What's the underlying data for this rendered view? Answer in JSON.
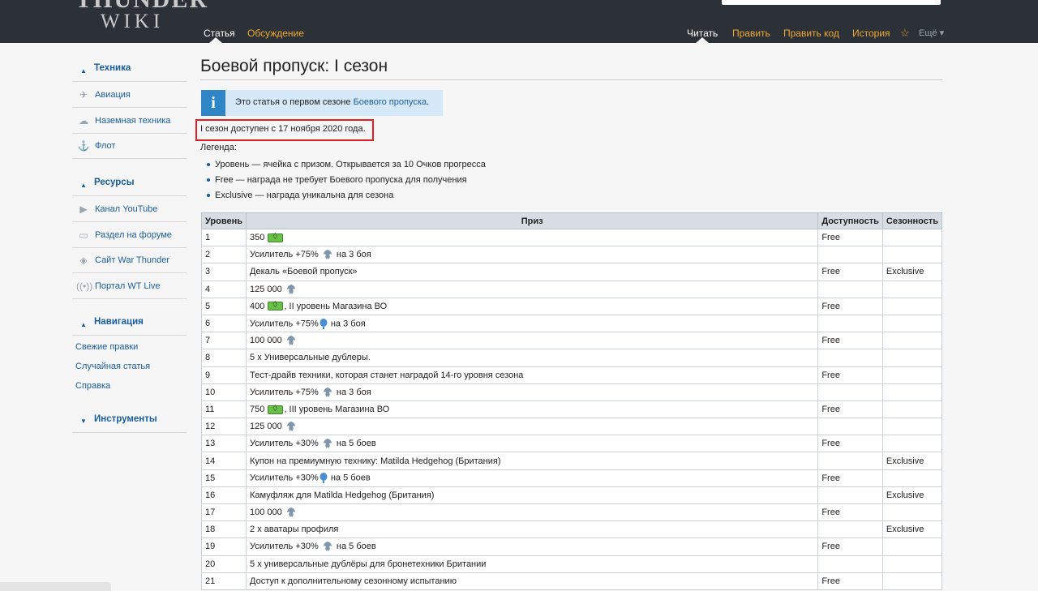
{
  "header": {
    "logo_top": "THUNDER",
    "logo_bottom": "WIKI",
    "tabs_left": [
      "Статья",
      "Обсуждение"
    ],
    "tabs_right": [
      "Читать",
      "Править",
      "Править код",
      "История"
    ],
    "more_label": "Ещё"
  },
  "sidebar": {
    "section_tech": "Техника",
    "tech_items": [
      "Авиация",
      "Наземная техника",
      "Флот"
    ],
    "section_resources": "Ресурсы",
    "resource_items": [
      "Канал YouTube",
      "Раздел на форуме",
      "Сайт War Thunder",
      "Портал WT Live"
    ],
    "section_nav": "Навигация",
    "nav_items": [
      "Свежие правки",
      "Случайная статья",
      "Справка"
    ],
    "section_tools": "Инструменты"
  },
  "page": {
    "title": "Боевой пропуск: I сезон",
    "notice_prefix": "Это статья о первом сезоне ",
    "notice_link": "Боевого пропуска",
    "notice_suffix": ".",
    "availability": "I сезон доступен с 17 ноября 2020 года.",
    "legend_label": "Легенда:",
    "legend": [
      "Уровень — ячейка с призом. Открывается за 10 Очков прогресса",
      "Free — награда не требует Боевого пропуска для получения",
      "Exclusive — награда уникальна для сезона"
    ]
  },
  "table": {
    "headers": [
      "Уровень",
      "Приз",
      "Доступность",
      "Сезонность"
    ],
    "rows": [
      {
        "level": "1",
        "pre": "350",
        "icon": "lion",
        "post": "",
        "avail": "Free",
        "season": ""
      },
      {
        "level": "2",
        "pre": "Усилитель +75%",
        "icon": "eagle",
        "post": "на 3 боя",
        "avail": "",
        "season": ""
      },
      {
        "level": "3",
        "pre": "Декаль «Боевой пропуск»",
        "icon": "",
        "post": "",
        "avail": "Free",
        "season": "Exclusive"
      },
      {
        "level": "4",
        "pre": "125 000",
        "icon": "eagle",
        "post": "",
        "avail": "",
        "season": ""
      },
      {
        "level": "5",
        "pre": "400",
        "icon": "lion",
        "post": ", II уровень Магазина ВО",
        "avail": "Free",
        "season": ""
      },
      {
        "level": "6",
        "pre": "Усилитель +75%",
        "icon": "balloon",
        "post": "на 3 боя",
        "avail": "",
        "season": ""
      },
      {
        "level": "7",
        "pre": "100 000",
        "icon": "eagle",
        "post": "",
        "avail": "Free",
        "season": ""
      },
      {
        "level": "8",
        "pre": "5 x Универсальные дублеры.",
        "icon": "",
        "post": "",
        "avail": "",
        "season": ""
      },
      {
        "level": "9",
        "pre": "Тест-драйв техники, которая станет наградой 14-го уровня сезона",
        "icon": "",
        "post": "",
        "avail": "Free",
        "season": ""
      },
      {
        "level": "10",
        "pre": "Усилитель +75%",
        "icon": "eagle",
        "post": "на 3 боя",
        "avail": "",
        "season": ""
      },
      {
        "level": "11",
        "pre": "750",
        "icon": "lion",
        "post": ", III уровень Магазина ВО",
        "avail": "Free",
        "season": ""
      },
      {
        "level": "12",
        "pre": "125 000",
        "icon": "eagle",
        "post": "",
        "avail": "",
        "season": ""
      },
      {
        "level": "13",
        "pre": "Усилитель +30%",
        "icon": "eagle",
        "post": "на 5 боев",
        "avail": "Free",
        "season": ""
      },
      {
        "level": "14",
        "pre": "Купон на премиумную технику: Matilda Hedgehog (Британия)",
        "icon": "",
        "post": "",
        "avail": "",
        "season": "Exclusive"
      },
      {
        "level": "15",
        "pre": "Усилитель +30%",
        "icon": "balloon",
        "post": "на 5 боев",
        "avail": "Free",
        "season": ""
      },
      {
        "level": "16",
        "pre": "Камуфляж для Matilda Hedgehog (Британия)",
        "icon": "",
        "post": "",
        "avail": "",
        "season": "Exclusive"
      },
      {
        "level": "17",
        "pre": "100 000",
        "icon": "eagle",
        "post": "",
        "avail": "Free",
        "season": ""
      },
      {
        "level": "18",
        "pre": "2 x аватары профиля",
        "icon": "",
        "post": "",
        "avail": "",
        "season": "Exclusive"
      },
      {
        "level": "19",
        "pre": "Усилитель +30%",
        "icon": "eagle",
        "post": "на 5 боев",
        "avail": "Free",
        "season": ""
      },
      {
        "level": "20",
        "pre": "5 x универсальные дублёры для бронетехники Британии",
        "icon": "",
        "post": "",
        "avail": "",
        "season": ""
      },
      {
        "level": "21",
        "pre": "Доступ к дополнительному сезонному испытанию",
        "icon": "",
        "post": "",
        "avail": "Free",
        "season": ""
      }
    ]
  },
  "colors": {
    "header_bg": "#2b3137",
    "link": "#1a5d9c",
    "tab_link": "#f0a830",
    "highlight": "#e02020"
  }
}
